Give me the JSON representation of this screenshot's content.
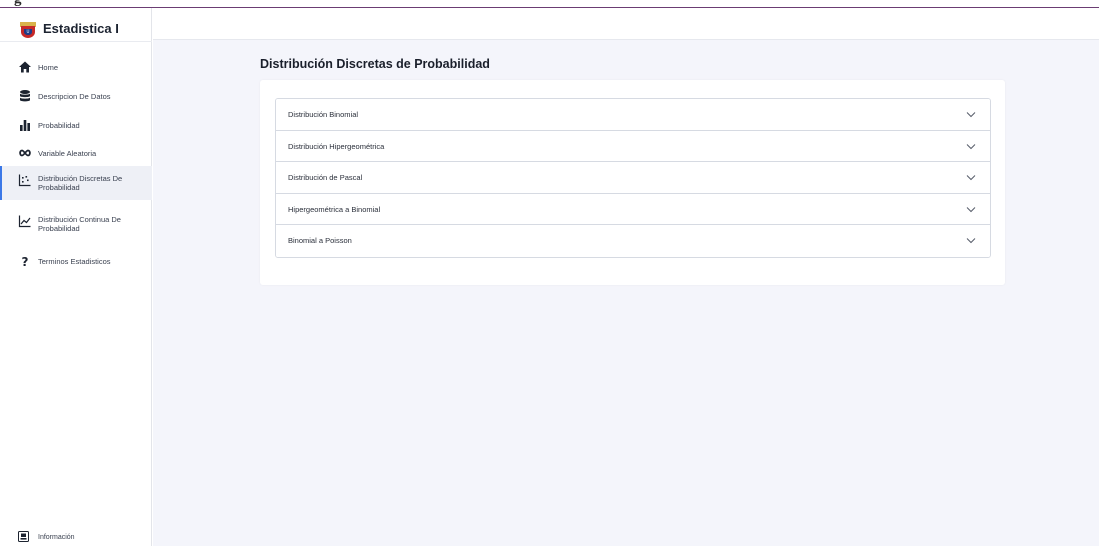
{
  "window": {
    "clipped_title": "g"
  },
  "brand": {
    "title": "Estadistica I",
    "logo_icon": "university-crest-icon"
  },
  "sidebar": {
    "items": [
      {
        "label": "Home",
        "icon": "home-icon",
        "active": false
      },
      {
        "label": "Descripcion De Datos",
        "icon": "database-icon",
        "active": false
      },
      {
        "label": "Probabilidad",
        "icon": "bar-chart-icon",
        "active": false
      },
      {
        "label": "Variable Aleatoria",
        "icon": "infinity-icon",
        "active": false
      },
      {
        "label_line1": "Distribución Discretas De",
        "label_line2": "Probabilidad",
        "icon": "scatter-chart-icon",
        "active": true
      },
      {
        "label_line1": "Distribución Continua De",
        "label_line2": "Probabilidad",
        "icon": "line-chart-icon",
        "active": false
      },
      {
        "label": "Terminos Estadisticos",
        "icon": "question-mark-icon",
        "active": false
      }
    ],
    "footer": {
      "label": "Información",
      "icon": "info-box-icon"
    }
  },
  "main": {
    "title": "Distribución Discretas de Probabilidad",
    "accordion": [
      {
        "label": "Distribución Binomial"
      },
      {
        "label": "Distribución Hipergeométrica"
      },
      {
        "label": "Distribución de Pascal"
      },
      {
        "label": "Hipergeométrica a Binomial"
      },
      {
        "label": "Binomial a Poisson"
      }
    ]
  },
  "colors": {
    "accent": "#3b78e7",
    "background": "#f4f5fb",
    "active_bg": "#eef0f6"
  }
}
